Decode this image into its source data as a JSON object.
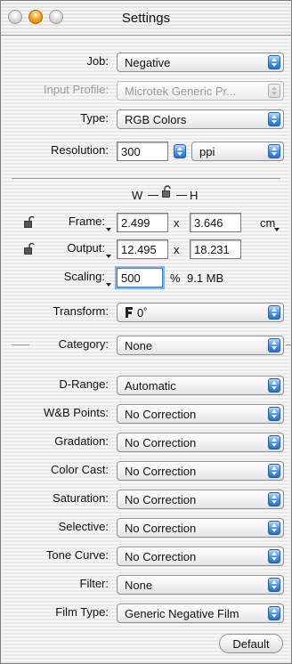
{
  "window": {
    "title": "Settings"
  },
  "job": {
    "label": "Job:",
    "value": "Negative"
  },
  "input_profile": {
    "label": "Input Profile:",
    "value": "Microtek Generic Pr..."
  },
  "type": {
    "label": "Type:",
    "value": "RGB Colors"
  },
  "resolution": {
    "label": "Resolution:",
    "value": "300",
    "unit": "ppi"
  },
  "dims_header": {
    "w": "W",
    "h": "H"
  },
  "frame": {
    "label": "Frame:",
    "w": "2.499",
    "x": "x",
    "h": "3.646",
    "unit": "cm"
  },
  "output": {
    "label": "Output:",
    "w": "12.495",
    "x": "x",
    "h": "18.231"
  },
  "scaling": {
    "label": "Scaling:",
    "value": "500",
    "percent": "%",
    "size": "9.1 MB"
  },
  "transform": {
    "label": "Transform:",
    "value": "0˚"
  },
  "category": {
    "label": "Category:",
    "value": "None"
  },
  "drange": {
    "label": "D-Range:",
    "value": "Automatic"
  },
  "wb_points": {
    "label": "W&B Points:",
    "value": "No Correction"
  },
  "gradation": {
    "label": "Gradation:",
    "value": "No Correction"
  },
  "color_cast": {
    "label": "Color Cast:",
    "value": "No Correction"
  },
  "saturation": {
    "label": "Saturation:",
    "value": "No Correction"
  },
  "selective": {
    "label": "Selective:",
    "value": "No Correction"
  },
  "tone_curve": {
    "label": "Tone Curve:",
    "value": "No Correction"
  },
  "filter": {
    "label": "Filter:",
    "value": "None"
  },
  "film_type": {
    "label": "Film Type:",
    "value": "Generic Negative Film"
  },
  "default_button": {
    "label": "Default"
  }
}
